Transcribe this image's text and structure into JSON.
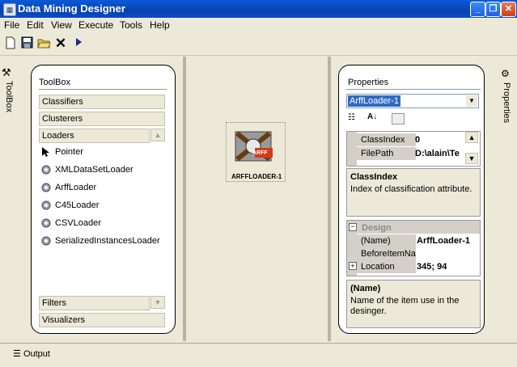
{
  "window": {
    "title": "Data Mining Designer"
  },
  "menu": [
    "File",
    "Edit",
    "View",
    "Execute",
    "Tools",
    "Help"
  ],
  "toolbar": {
    "icons": [
      "new-icon",
      "save-icon",
      "open-icon",
      "delete-icon",
      "run-icon"
    ]
  },
  "side_tabs": {
    "left": "ToolBox",
    "right": "Properties"
  },
  "toolbox": {
    "title": "ToolBox",
    "categories_top": [
      "Classifiers",
      "Clusterers",
      "Loaders"
    ],
    "items": [
      "Pointer",
      "XMLDataSetLoader",
      "ArffLoader",
      "C45Loader",
      "CSVLoader",
      "SerializedInstancesLoader"
    ],
    "categories_bottom": [
      "Filters",
      "Visualizers"
    ]
  },
  "canvas": {
    "node_label": "ARFFLOADER-1",
    "node_badge": "ARFF"
  },
  "properties": {
    "title": "Properties",
    "selected_object": "ArffLoader-1",
    "grid1": [
      {
        "name": "ClassIndex",
        "value": "0"
      },
      {
        "name": "FilePath",
        "value": "D:\\alain\\Te"
      }
    ],
    "desc1": {
      "title": "ClassIndex",
      "text": "Index of classification attribute."
    },
    "grid2_category": "Design",
    "grid2": [
      {
        "name": "(Name)",
        "value": "ArffLoader-1",
        "expand": ""
      },
      {
        "name": "BeforeItemNa",
        "value": "",
        "expand": ""
      },
      {
        "name": "Location",
        "value": "345; 94",
        "expand": "+"
      }
    ],
    "desc2": {
      "title": "(Name)",
      "text": "Name of the item use in the desinger."
    }
  },
  "status": {
    "output_label": "Output"
  },
  "colors": {
    "titlebar": "#0a4bc4",
    "selection": "#316ac5",
    "chrome": "#ece9d8"
  }
}
